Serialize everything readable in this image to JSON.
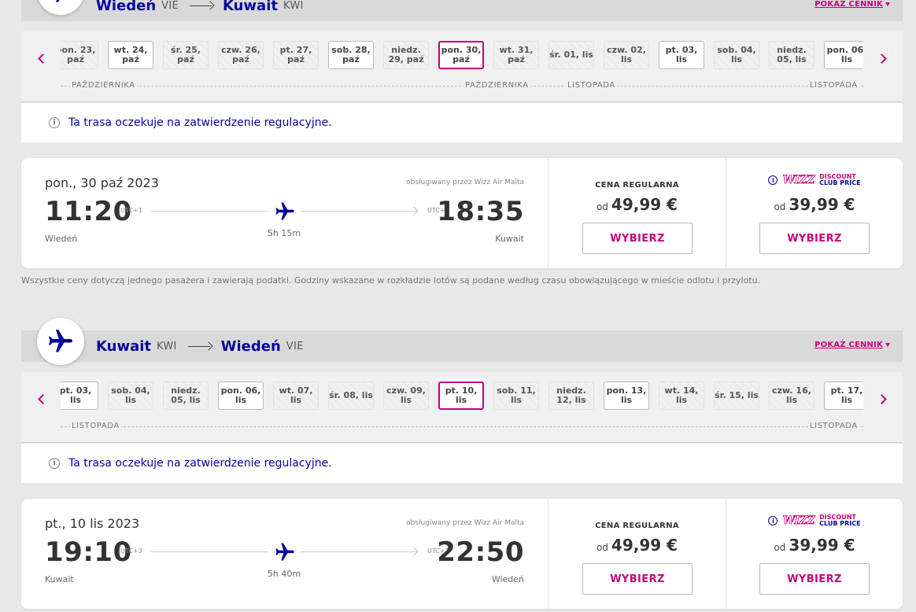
{
  "show_prices": "POKAŻ CENNIK",
  "disclaimer": "Wszystkie ceny dotyczą jednego pasażera i zawierają podatki. Godziny wskazane w rozkładzie lotów są podane według czasu obowiązującego w mieście odlotu i przylotu.",
  "outbound": {
    "from_city": "Wiedeń",
    "from_code": "VIE",
    "to_city": "Kuwait",
    "to_code": "KWI",
    "days": [
      {
        "label": "pon. 23, paź",
        "state": "hatch"
      },
      {
        "label": "wt. 24, paź",
        "state": "avail"
      },
      {
        "label": "śr. 25, paź",
        "state": "hatch"
      },
      {
        "label": "czw. 26, paź",
        "state": "hatch"
      },
      {
        "label": "pt. 27, paź",
        "state": "hatch"
      },
      {
        "label": "sob. 28, paź",
        "state": "avail"
      },
      {
        "label": "niedz. 29, paź",
        "state": "hatch"
      },
      {
        "label": "pon. 30, paź",
        "state": "selected"
      },
      {
        "label": "wt. 31, paź",
        "state": "hatch"
      },
      {
        "label": "śr. 01, lis",
        "state": "hatch"
      },
      {
        "label": "czw. 02, lis",
        "state": "hatch"
      },
      {
        "label": "pt. 03, lis",
        "state": "avail"
      },
      {
        "label": "sob. 04, lis",
        "state": "hatch"
      },
      {
        "label": "niedz. 05, lis",
        "state": "hatch"
      },
      {
        "label": "pon. 06, lis",
        "state": "avail"
      }
    ],
    "months": [
      "PAŹDZIERNIKA",
      "PAŹDZIERNIKA",
      "LISTOPADA",
      "LISTOPADA"
    ],
    "notice": "Ta trasa oczekuje na zatwierdzenie regulacyjne.",
    "flight": {
      "date": "pon., 30 paź 2023",
      "operator": "obsługiwany przez Wizz Air Malta",
      "dep_time": "11:20",
      "dep_tz": "UTC+1",
      "arr_time": "18:35",
      "arr_tz": "UTC+3",
      "duration": "5h 15m",
      "dep_city": "Wiedeń",
      "arr_city": "Kuwait"
    },
    "regular_label": "CENA REGULARNA",
    "od": "od",
    "regular_price": "49,99 €",
    "club_price": "39,99 €",
    "select_label": "WYBIERZ"
  },
  "inbound": {
    "from_city": "Kuwait",
    "from_code": "KWI",
    "to_city": "Wiedeń",
    "to_code": "VIE",
    "days": [
      {
        "label": "pt. 03, lis",
        "state": "avail"
      },
      {
        "label": "sob. 04, lis",
        "state": "hatch"
      },
      {
        "label": "niedz. 05, lis",
        "state": "hatch"
      },
      {
        "label": "pon. 06, lis",
        "state": "avail"
      },
      {
        "label": "wt. 07, lis",
        "state": "hatch"
      },
      {
        "label": "śr. 08, lis",
        "state": "hatch"
      },
      {
        "label": "czw. 09, lis",
        "state": "hatch"
      },
      {
        "label": "pt. 10, lis",
        "state": "selected"
      },
      {
        "label": "sob. 11, lis",
        "state": "hatch"
      },
      {
        "label": "niedz. 12, lis",
        "state": "hatch"
      },
      {
        "label": "pon. 13, lis",
        "state": "avail"
      },
      {
        "label": "wt. 14, lis",
        "state": "hatch"
      },
      {
        "label": "śr. 15, lis",
        "state": "hatch"
      },
      {
        "label": "czw. 16, lis",
        "state": "hatch"
      },
      {
        "label": "pt. 17, lis",
        "state": "avail"
      }
    ],
    "months": [
      "LISTOPADA",
      "LISTOPADA"
    ],
    "notice": "Ta trasa oczekuje na zatwierdzenie regulacyjne.",
    "flight": {
      "date": "pt., 10 lis 2023",
      "operator": "obsługiwany przez Wizz Air Malta",
      "dep_time": "19:10",
      "dep_tz": "UTC+3",
      "arr_time": "22:50",
      "arr_tz": "UTC+1",
      "duration": "5h 40m",
      "dep_city": "Kuwait",
      "arr_city": "Wiedeń"
    },
    "regular_label": "CENA REGULARNA",
    "od": "od",
    "regular_price": "49,99 €",
    "club_price": "39,99 €",
    "select_label": "WYBIERZ"
  },
  "club_logo_text": "WIZZ",
  "club_line1": "DISCOUNT",
  "club_line2": "CLUB PRICE",
  "icons": {
    "info": "info-icon",
    "plane": "plane-icon",
    "prev": "chevron-left-icon",
    "next": "chevron-right-icon"
  },
  "colors": {
    "brand_blue": "#06049a",
    "brand_pink": "#c6007e"
  }
}
